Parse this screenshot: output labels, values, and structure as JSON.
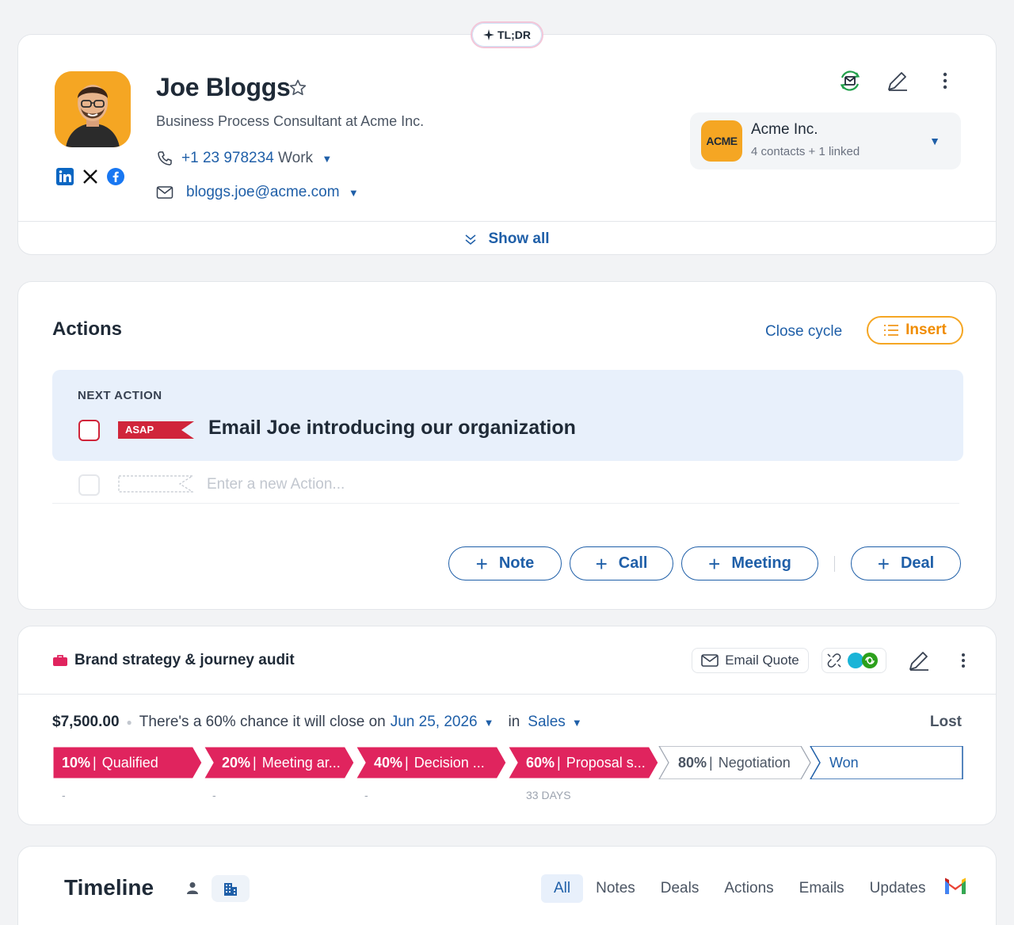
{
  "tldr": {
    "label": "TL;DR"
  },
  "contact": {
    "name": "Joe Bloggs",
    "title": "Business Process Consultant at Acme Inc.",
    "phone": "+1 23 978234",
    "phone_type": "Work",
    "email": "bloggs.joe@acme.com"
  },
  "company": {
    "logo_text": "ACME",
    "name": "Acme Inc.",
    "subtitle": "4 contacts + 1 linked"
  },
  "show_all": "Show all",
  "actions": {
    "title": "Actions",
    "close_cycle": "Close cycle",
    "insert": "Insert",
    "next_action_label": "NEXT ACTION",
    "priority": "ASAP",
    "next_action_text": "Email Joe introducing our organization",
    "new_action_placeholder": "Enter a new Action...",
    "buttons": {
      "note": "Note",
      "call": "Call",
      "meeting": "Meeting",
      "deal": "Deal"
    }
  },
  "deal": {
    "title": "Brand strategy & journey audit",
    "email_quote": "Email Quote",
    "amount": "$7,500.00",
    "chance_text": "There's a 60% chance it will close on",
    "close_date": "Jun 25, 2026",
    "in_label": "in",
    "pipeline": "Sales",
    "lost": "Lost",
    "stages": [
      {
        "pct": "10%",
        "name": "Qualified",
        "sub": "-",
        "active": true
      },
      {
        "pct": "20%",
        "name": "Meeting ar...",
        "sub": "-",
        "active": true
      },
      {
        "pct": "40%",
        "name": "Decision ...",
        "sub": "-",
        "active": true
      },
      {
        "pct": "60%",
        "name": "Proposal s...",
        "sub": "33 DAYS",
        "active": true
      },
      {
        "pct": "80%",
        "name": "Negotiation",
        "sub": "",
        "active": false
      },
      {
        "pct": "",
        "name": "Won",
        "sub": "",
        "active": false
      }
    ]
  },
  "timeline": {
    "title": "Timeline",
    "tabs": [
      "All",
      "Notes",
      "Deals",
      "Actions",
      "Emails",
      "Updates"
    ]
  },
  "colors": {
    "accent": "#1f5fa8",
    "stage_active": "#e0245e",
    "priority_red": "#d0253a",
    "warning": "#f08c00"
  },
  "icons": [
    "sparkle-icon",
    "star-icon",
    "phone-icon",
    "mail-icon",
    "linkedin-icon",
    "x-icon",
    "facebook-icon",
    "email-sync-icon",
    "pencil-icon",
    "more-vertical-icon",
    "chevron-down-icon",
    "list-icon",
    "plus-icon",
    "briefcase-icon",
    "unlink-icon",
    "person-icon",
    "building-icon",
    "gmail-icon"
  ]
}
